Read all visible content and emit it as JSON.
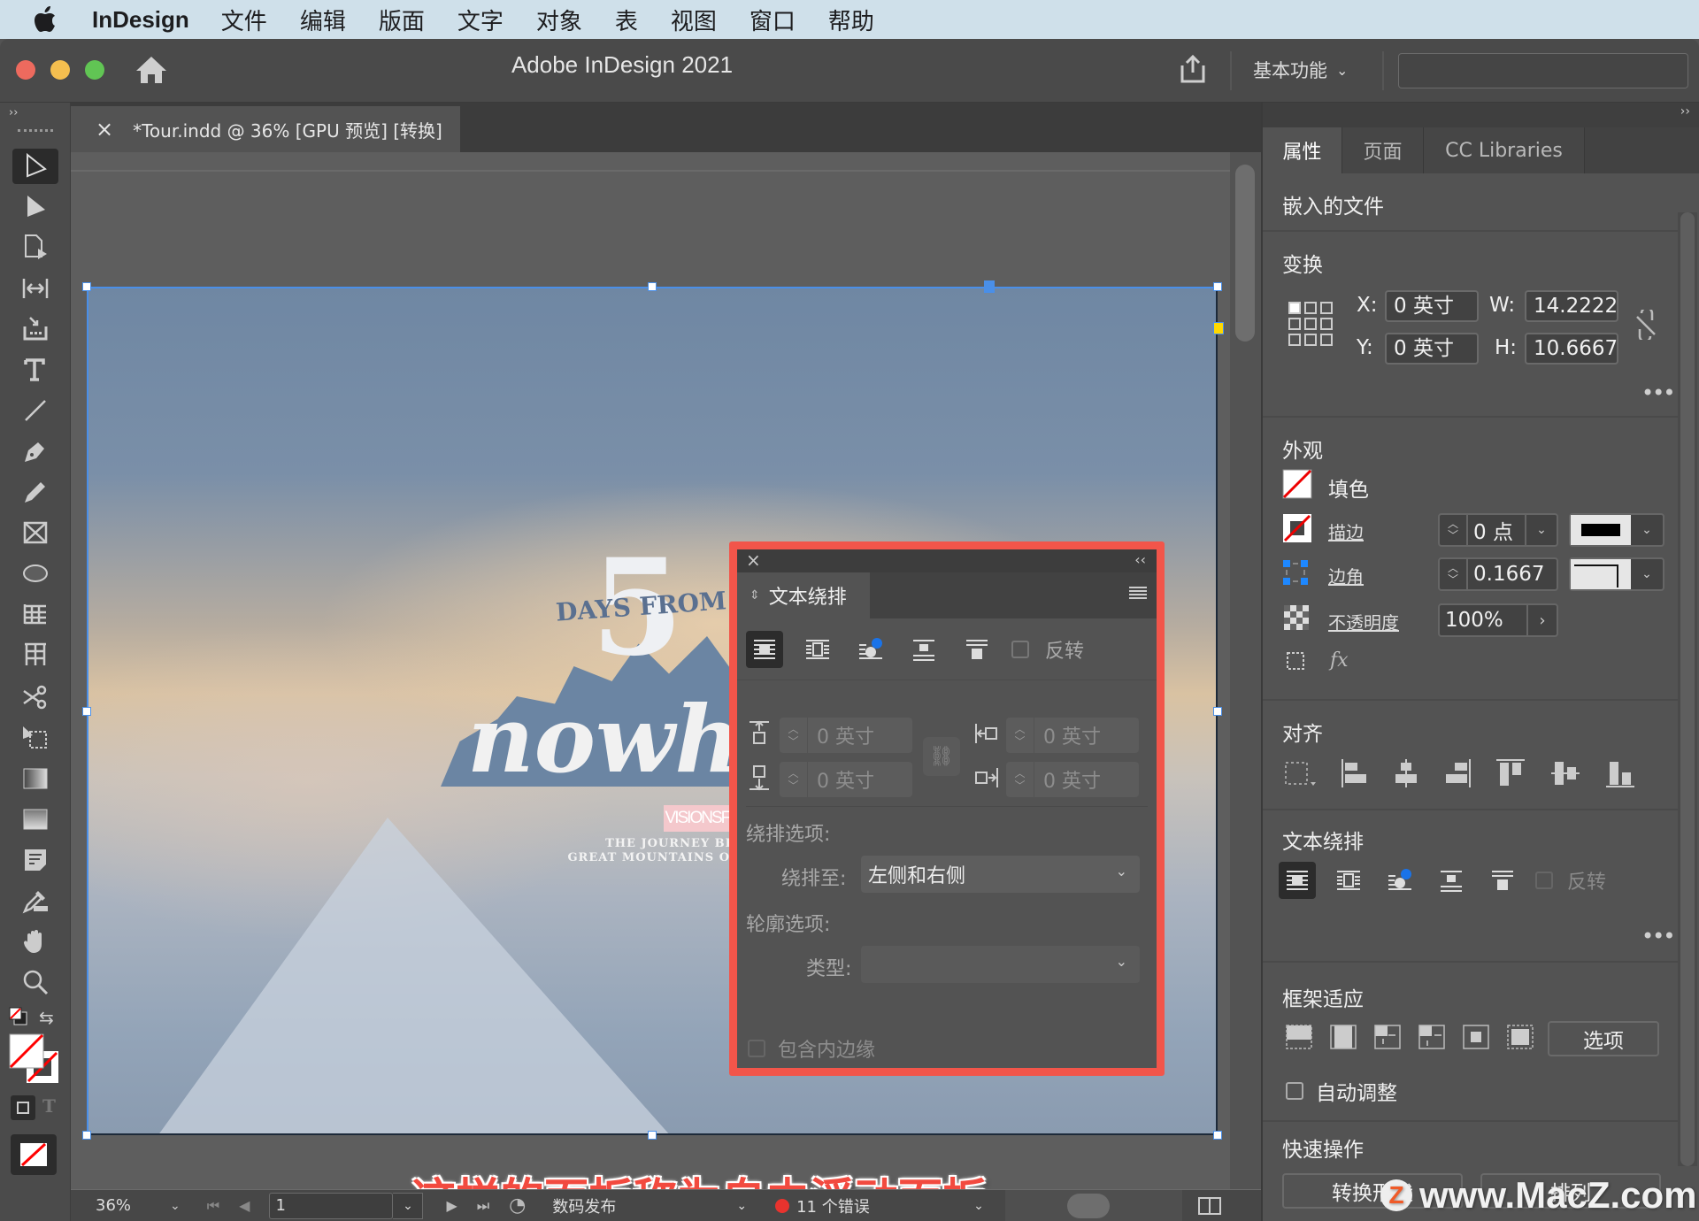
{
  "menubar": {
    "app_name": "InDesign",
    "items": [
      "文件",
      "编辑",
      "版面",
      "文字",
      "对象",
      "表",
      "视图",
      "窗口",
      "帮助"
    ]
  },
  "titlebar": {
    "title": "Adobe InDesign 2021",
    "workspace": "基本功能",
    "search_placeholder": ""
  },
  "document_tab": {
    "close": "×",
    "label": "*Tour.indd @ 36% [GPU 预览] [转换]"
  },
  "toolbox": {
    "collapse": "››",
    "tools": [
      "selection",
      "direct-selection",
      "page",
      "gap",
      "content-collector",
      "type",
      "line",
      "pen",
      "pencil",
      "rectangle-frame",
      "ellipse",
      "table",
      "table-alt",
      "scissors",
      "free-transform",
      "gradient-swatch",
      "gradient-feather",
      "note",
      "eyedropper",
      "hand",
      "zoom"
    ]
  },
  "artwork": {
    "number": "5",
    "days_from": "DAYS FROM",
    "title": "nowhe",
    "tag": "VISIONSFROMNEPAL",
    "line1": "THE JOURNEY BEGINS IN TH",
    "line2": "GREAT MOUNTAINS OF THE HIMA"
  },
  "caption": "这样的面板称为自由浮动面板",
  "statusbar": {
    "zoom": "36%",
    "page": "1",
    "preflight_profile": "数码发布",
    "errors": "11 个错误",
    "error_color": "#e8332e"
  },
  "floating_panel": {
    "close": "×",
    "collapse": "‹‹",
    "tab": "文本绕排",
    "invert_label": "反转",
    "top_offset": "0 英寸",
    "bottom_offset": "0 英寸",
    "left_offset": "0 英寸",
    "right_offset": "0 英寸",
    "wrap_options_label": "绕排选项:",
    "wrap_to_label": "绕排至:",
    "wrap_to_value": "左侧和右侧",
    "contour_options_label": "轮廓选项:",
    "type_label": "类型:",
    "type_value": "",
    "include_inside_edges": "包含内边缘",
    "selected_wrap": "no-text-wrap"
  },
  "right_panel": {
    "collapse": "››",
    "tabs": [
      {
        "label": "属性",
        "active": true
      },
      {
        "label": "页面",
        "active": false
      },
      {
        "label": "CC Libraries",
        "active": false
      }
    ],
    "object_type": "嵌入的文件",
    "transform": {
      "title": "变换",
      "x_label": "X:",
      "x": "0 英寸",
      "y_label": "Y:",
      "y": "0 英寸",
      "w_label": "W:",
      "w": "14.2222",
      "h_label": "H:",
      "h": "10.6667"
    },
    "appearance": {
      "title": "外观",
      "fill_label": "填色",
      "stroke_label": "描边",
      "stroke_weight": "0 点",
      "corner_label": "边角",
      "corner_value": "0.1667",
      "opacity_label": "不透明度",
      "opacity_value": "100%"
    },
    "align": {
      "title": "对齐"
    },
    "text_wrap": {
      "title": "文本绕排",
      "invert_label": "反转"
    },
    "frame_fitting": {
      "title": "框架适应",
      "options_button": "选项",
      "auto_fit_label": "自动调整"
    },
    "quick_actions": {
      "title": "快速操作",
      "buttons": [
        "转换形状",
        "排列"
      ]
    }
  },
  "watermark": "www.MacZ.com",
  "colors": {
    "accent_blue": "#1a73e8",
    "highlight_red": "#f2554a",
    "traffic_red": "#ed6a5e",
    "traffic_yellow": "#f5bf4f",
    "traffic_green": "#61c554"
  }
}
